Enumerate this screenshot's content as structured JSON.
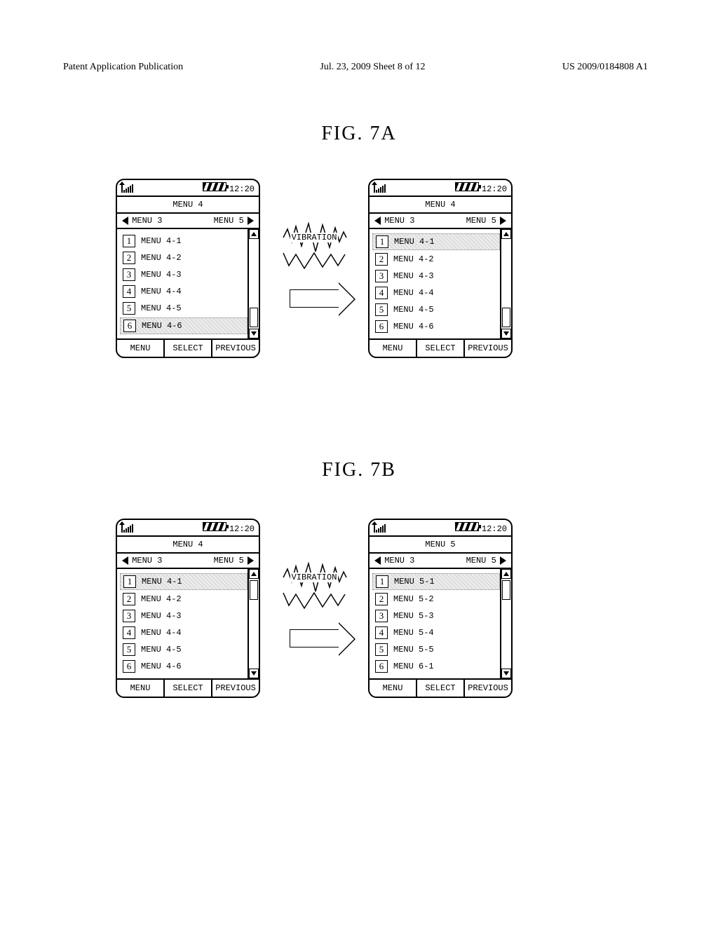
{
  "header": {
    "left": "Patent Application Publication",
    "center": "Jul. 23, 2009  Sheet 8 of 12",
    "right": "US 2009/0184808 A1"
  },
  "figA": {
    "label": "FIG.  7A"
  },
  "figB": {
    "label": "FIG.  7B"
  },
  "transition": {
    "vibration": "VIBRATION"
  },
  "status": {
    "time": "12:20"
  },
  "softkeys": {
    "menu": "MENU",
    "select": "SELECT",
    "previous": "PREVIOUS"
  },
  "nav": {
    "left": "MENU 3",
    "right": "MENU 5"
  },
  "phones": {
    "a_left": {
      "title": "MENU 4",
      "selected_index": 5,
      "thumb_pos": "bottom",
      "items": [
        {
          "n": "1",
          "label": "MENU 4-1"
        },
        {
          "n": "2",
          "label": "MENU 4-2"
        },
        {
          "n": "3",
          "label": "MENU 4-3"
        },
        {
          "n": "4",
          "label": "MENU 4-4"
        },
        {
          "n": "5",
          "label": "MENU 4-5"
        },
        {
          "n": "6",
          "label": "MENU 4-6"
        }
      ]
    },
    "a_right": {
      "title": "MENU 4",
      "selected_index": 0,
      "thumb_pos": "bottom",
      "items": [
        {
          "n": "1",
          "label": "MENU 4-1"
        },
        {
          "n": "2",
          "label": "MENU 4-2"
        },
        {
          "n": "3",
          "label": "MENU 4-3"
        },
        {
          "n": "4",
          "label": "MENU 4-4"
        },
        {
          "n": "5",
          "label": "MENU 4-5"
        },
        {
          "n": "6",
          "label": "MENU 4-6"
        }
      ]
    },
    "b_left": {
      "title": "MENU 4",
      "selected_index": 0,
      "thumb_pos": "top",
      "items": [
        {
          "n": "1",
          "label": "MENU 4-1"
        },
        {
          "n": "2",
          "label": "MENU 4-2"
        },
        {
          "n": "3",
          "label": "MENU 4-3"
        },
        {
          "n": "4",
          "label": "MENU 4-4"
        },
        {
          "n": "5",
          "label": "MENU 4-5"
        },
        {
          "n": "6",
          "label": "MENU 4-6"
        }
      ]
    },
    "b_right": {
      "title": "MENU 5",
      "selected_index": 0,
      "thumb_pos": "top",
      "items": [
        {
          "n": "1",
          "label": "MENU 5-1"
        },
        {
          "n": "2",
          "label": "MENU 5-2"
        },
        {
          "n": "3",
          "label": "MENU 5-3"
        },
        {
          "n": "4",
          "label": "MENU 5-4"
        },
        {
          "n": "5",
          "label": "MENU 5-5"
        },
        {
          "n": "6",
          "label": "MENU 6-1"
        }
      ]
    }
  }
}
